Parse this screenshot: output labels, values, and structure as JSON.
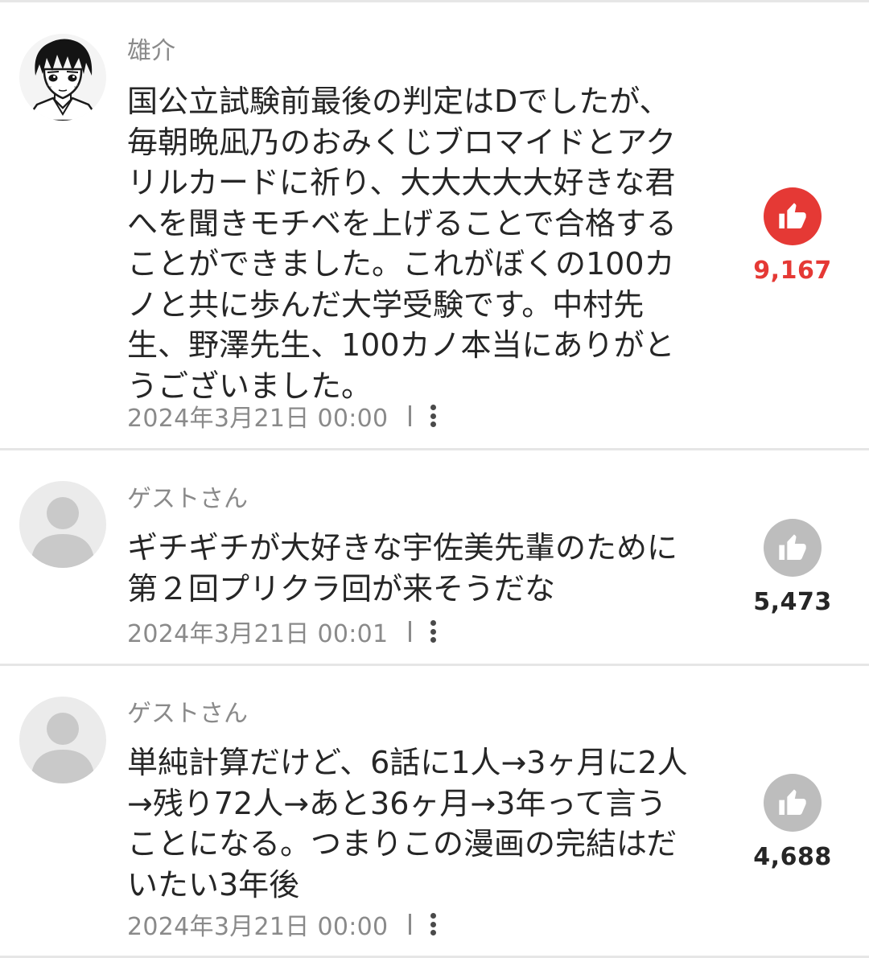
{
  "colors": {
    "liked_accent": "#e53935",
    "unliked_button": "#bdbdbd",
    "count_default": "#262626",
    "meta_gray": "#8a8a8a"
  },
  "comments": [
    {
      "author": "雄介",
      "avatar": "manga-character-avatar",
      "text": "国公立試験前最後の判定はDでしたが、\n毎朝晩凪乃のおみくじブロマイドとアク\nリルカードに祈り、大大大大大好きな君\nへを聞きモチベを上げることで合格する\nことができました。これがぼくの100カ\nノと共に歩んだ大学受験です。中村先\n生、野澤先生、100カノ本当にありがと\nうございました。",
      "timestamp": "2024年3月21日 00:00",
      "likes": "9,167",
      "liked": true
    },
    {
      "author": "ゲストさん",
      "avatar": "default-user-avatar",
      "text": "ギチギチが大好きな宇佐美先輩のために\n第２回プリクラ回が来そうだな",
      "timestamp": "2024年3月21日 00:01",
      "likes": "5,473",
      "liked": false
    },
    {
      "author": "ゲストさん",
      "avatar": "default-user-avatar",
      "text": "単純計算だけど、6話に1人→3ヶ月に2人\n→残り72人→あと36ヶ月→3年って言う\nことになる。つまりこの漫画の完結はだ\nいたい3年後",
      "timestamp": "2024年3月21日 00:00",
      "likes": "4,688",
      "liked": false
    }
  ]
}
